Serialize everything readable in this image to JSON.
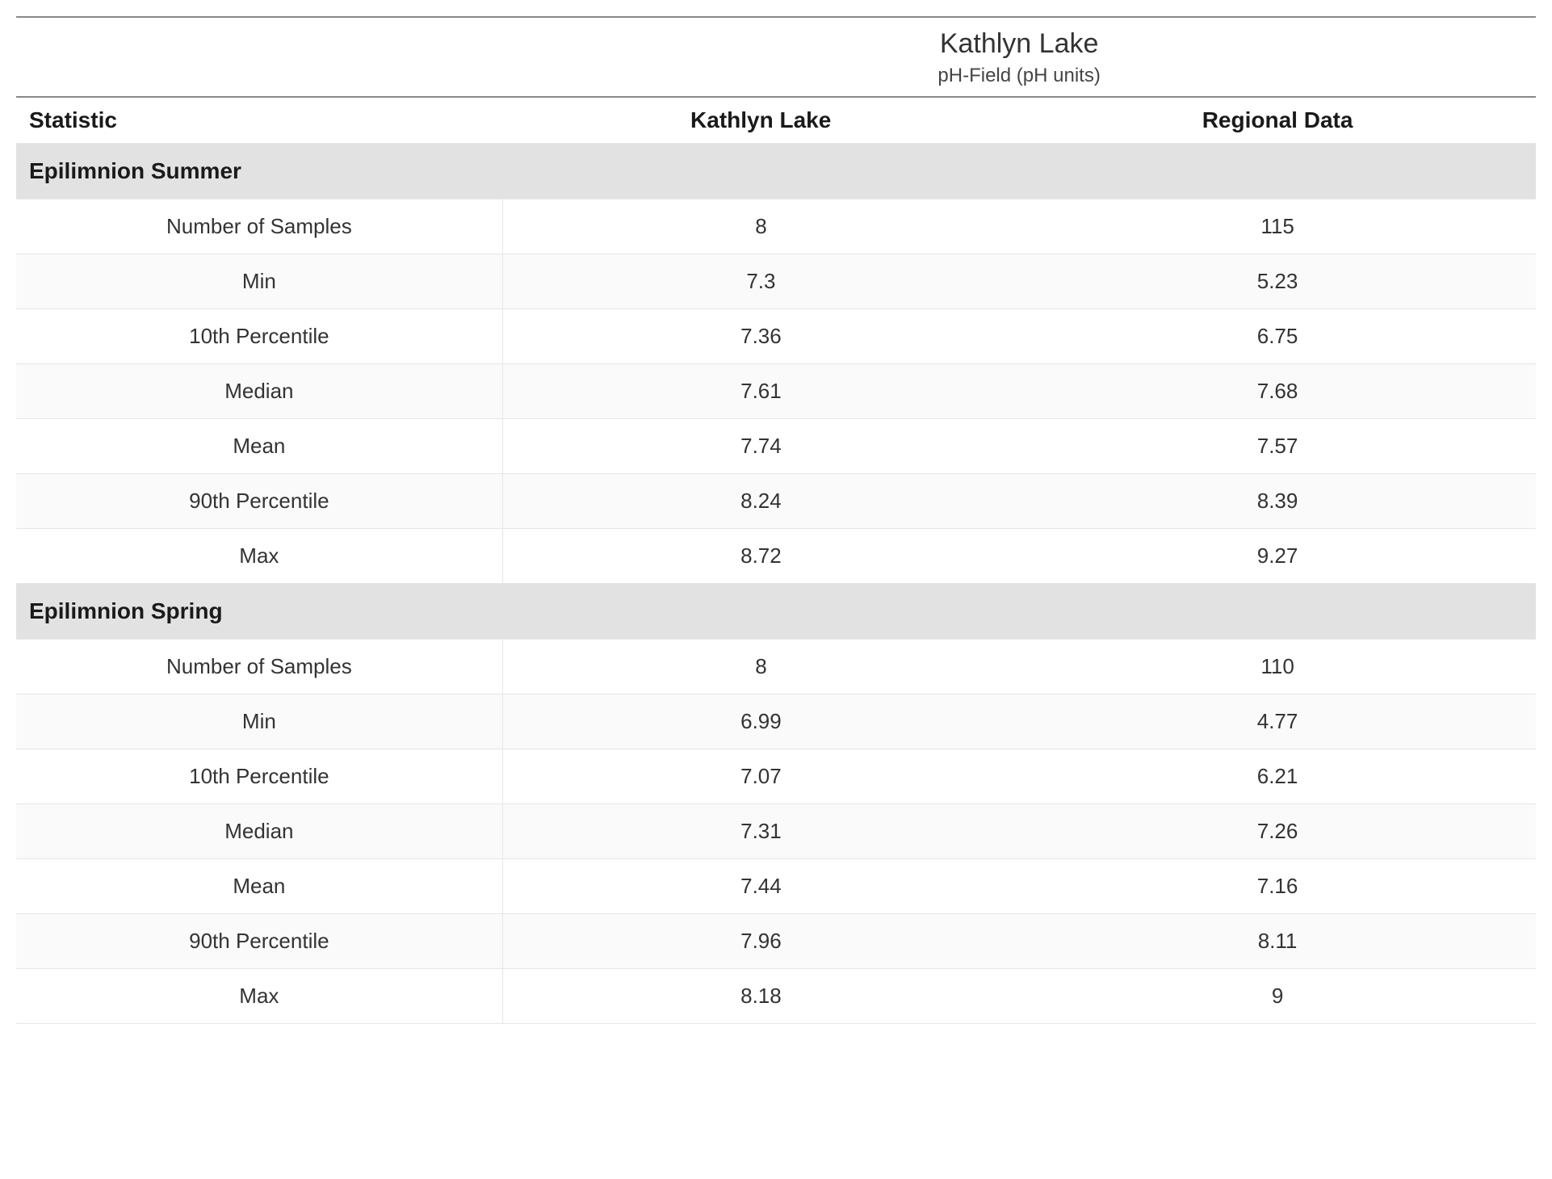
{
  "header": {
    "lake_name": "Kathlyn Lake",
    "parameter_label": "pH-Field (pH units)"
  },
  "columns": {
    "statistic": "Statistic",
    "lake": "Kathlyn Lake",
    "regional": "Regional Data"
  },
  "sections": [
    {
      "title": "Epilimnion Summer",
      "rows": [
        {
          "stat": "Number of Samples",
          "lake": "8",
          "regional": "115"
        },
        {
          "stat": "Min",
          "lake": "7.3",
          "regional": "5.23"
        },
        {
          "stat": "10th Percentile",
          "lake": "7.36",
          "regional": "6.75"
        },
        {
          "stat": "Median",
          "lake": "7.61",
          "regional": "7.68"
        },
        {
          "stat": "Mean",
          "lake": "7.74",
          "regional": "7.57"
        },
        {
          "stat": "90th Percentile",
          "lake": "8.24",
          "regional": "8.39"
        },
        {
          "stat": "Max",
          "lake": "8.72",
          "regional": "9.27"
        }
      ]
    },
    {
      "title": "Epilimnion Spring",
      "rows": [
        {
          "stat": "Number of Samples",
          "lake": "8",
          "regional": "110"
        },
        {
          "stat": "Min",
          "lake": "6.99",
          "regional": "4.77"
        },
        {
          "stat": "10th Percentile",
          "lake": "7.07",
          "regional": "6.21"
        },
        {
          "stat": "Median",
          "lake": "7.31",
          "regional": "7.26"
        },
        {
          "stat": "Mean",
          "lake": "7.44",
          "regional": "7.16"
        },
        {
          "stat": "90th Percentile",
          "lake": "7.96",
          "regional": "8.11"
        },
        {
          "stat": "Max",
          "lake": "8.18",
          "regional": "9"
        }
      ]
    }
  ]
}
